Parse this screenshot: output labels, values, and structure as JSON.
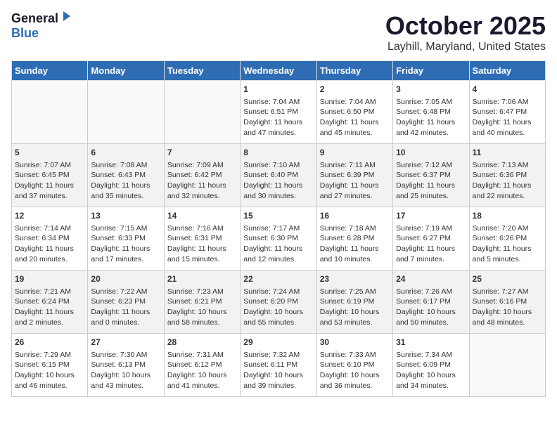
{
  "header": {
    "logo_general": "General",
    "logo_blue": "Blue",
    "month": "October 2025",
    "location": "Layhill, Maryland, United States"
  },
  "days_of_week": [
    "Sunday",
    "Monday",
    "Tuesday",
    "Wednesday",
    "Thursday",
    "Friday",
    "Saturday"
  ],
  "weeks": [
    [
      {
        "day": "",
        "content": ""
      },
      {
        "day": "",
        "content": ""
      },
      {
        "day": "",
        "content": ""
      },
      {
        "day": "1",
        "content": "Sunrise: 7:04 AM\nSunset: 6:51 PM\nDaylight: 11 hours\nand 47 minutes."
      },
      {
        "day": "2",
        "content": "Sunrise: 7:04 AM\nSunset: 6:50 PM\nDaylight: 11 hours\nand 45 minutes."
      },
      {
        "day": "3",
        "content": "Sunrise: 7:05 AM\nSunset: 6:48 PM\nDaylight: 11 hours\nand 42 minutes."
      },
      {
        "day": "4",
        "content": "Sunrise: 7:06 AM\nSunset: 6:47 PM\nDaylight: 11 hours\nand 40 minutes."
      }
    ],
    [
      {
        "day": "5",
        "content": "Sunrise: 7:07 AM\nSunset: 6:45 PM\nDaylight: 11 hours\nand 37 minutes."
      },
      {
        "day": "6",
        "content": "Sunrise: 7:08 AM\nSunset: 6:43 PM\nDaylight: 11 hours\nand 35 minutes."
      },
      {
        "day": "7",
        "content": "Sunrise: 7:09 AM\nSunset: 6:42 PM\nDaylight: 11 hours\nand 32 minutes."
      },
      {
        "day": "8",
        "content": "Sunrise: 7:10 AM\nSunset: 6:40 PM\nDaylight: 11 hours\nand 30 minutes."
      },
      {
        "day": "9",
        "content": "Sunrise: 7:11 AM\nSunset: 6:39 PM\nDaylight: 11 hours\nand 27 minutes."
      },
      {
        "day": "10",
        "content": "Sunrise: 7:12 AM\nSunset: 6:37 PM\nDaylight: 11 hours\nand 25 minutes."
      },
      {
        "day": "11",
        "content": "Sunrise: 7:13 AM\nSunset: 6:36 PM\nDaylight: 11 hours\nand 22 minutes."
      }
    ],
    [
      {
        "day": "12",
        "content": "Sunrise: 7:14 AM\nSunset: 6:34 PM\nDaylight: 11 hours\nand 20 minutes."
      },
      {
        "day": "13",
        "content": "Sunrise: 7:15 AM\nSunset: 6:33 PM\nDaylight: 11 hours\nand 17 minutes."
      },
      {
        "day": "14",
        "content": "Sunrise: 7:16 AM\nSunset: 6:31 PM\nDaylight: 11 hours\nand 15 minutes."
      },
      {
        "day": "15",
        "content": "Sunrise: 7:17 AM\nSunset: 6:30 PM\nDaylight: 11 hours\nand 12 minutes."
      },
      {
        "day": "16",
        "content": "Sunrise: 7:18 AM\nSunset: 6:28 PM\nDaylight: 11 hours\nand 10 minutes."
      },
      {
        "day": "17",
        "content": "Sunrise: 7:19 AM\nSunset: 6:27 PM\nDaylight: 11 hours\nand 7 minutes."
      },
      {
        "day": "18",
        "content": "Sunrise: 7:20 AM\nSunset: 6:26 PM\nDaylight: 11 hours\nand 5 minutes."
      }
    ],
    [
      {
        "day": "19",
        "content": "Sunrise: 7:21 AM\nSunset: 6:24 PM\nDaylight: 11 hours\nand 2 minutes."
      },
      {
        "day": "20",
        "content": "Sunrise: 7:22 AM\nSunset: 6:23 PM\nDaylight: 11 hours\nand 0 minutes."
      },
      {
        "day": "21",
        "content": "Sunrise: 7:23 AM\nSunset: 6:21 PM\nDaylight: 10 hours\nand 58 minutes."
      },
      {
        "day": "22",
        "content": "Sunrise: 7:24 AM\nSunset: 6:20 PM\nDaylight: 10 hours\nand 55 minutes."
      },
      {
        "day": "23",
        "content": "Sunrise: 7:25 AM\nSunset: 6:19 PM\nDaylight: 10 hours\nand 53 minutes."
      },
      {
        "day": "24",
        "content": "Sunrise: 7:26 AM\nSunset: 6:17 PM\nDaylight: 10 hours\nand 50 minutes."
      },
      {
        "day": "25",
        "content": "Sunrise: 7:27 AM\nSunset: 6:16 PM\nDaylight: 10 hours\nand 48 minutes."
      }
    ],
    [
      {
        "day": "26",
        "content": "Sunrise: 7:29 AM\nSunset: 6:15 PM\nDaylight: 10 hours\nand 46 minutes."
      },
      {
        "day": "27",
        "content": "Sunrise: 7:30 AM\nSunset: 6:13 PM\nDaylight: 10 hours\nand 43 minutes."
      },
      {
        "day": "28",
        "content": "Sunrise: 7:31 AM\nSunset: 6:12 PM\nDaylight: 10 hours\nand 41 minutes."
      },
      {
        "day": "29",
        "content": "Sunrise: 7:32 AM\nSunset: 6:11 PM\nDaylight: 10 hours\nand 39 minutes."
      },
      {
        "day": "30",
        "content": "Sunrise: 7:33 AM\nSunset: 6:10 PM\nDaylight: 10 hours\nand 36 minutes."
      },
      {
        "day": "31",
        "content": "Sunrise: 7:34 AM\nSunset: 6:09 PM\nDaylight: 10 hours\nand 34 minutes."
      },
      {
        "day": "",
        "content": ""
      }
    ]
  ]
}
